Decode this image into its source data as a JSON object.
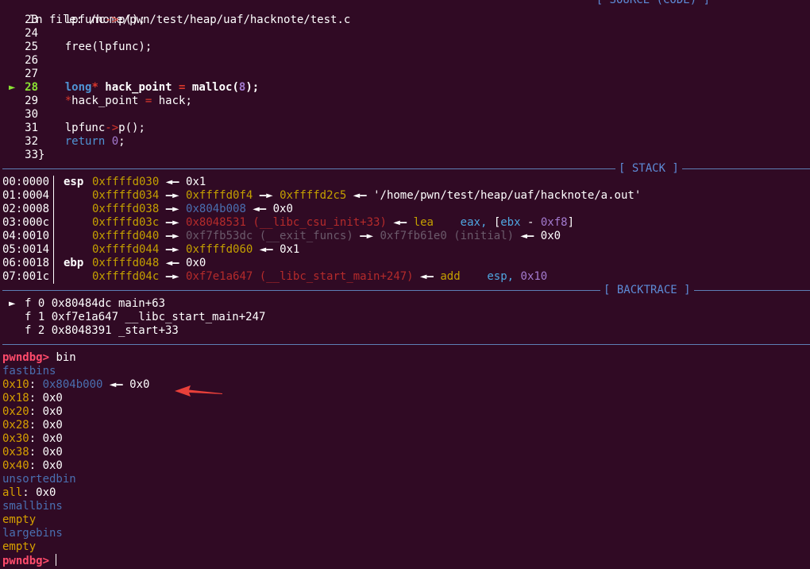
{
  "header": {
    "file_label": "In file: /home/pwn/test/heap/uaf/hacknote/test.c",
    "top_banner": "[ SOURCE (CODE) ]"
  },
  "source": {
    "lines": [
      {
        "num": "23",
        "code": "    lpfunc->p();"
      },
      {
        "num": "24",
        "code": ""
      },
      {
        "num": "25",
        "code": "    free(lpfunc);"
      },
      {
        "num": "26",
        "code": ""
      },
      {
        "num": "27",
        "code": ""
      },
      {
        "num": "28",
        "code": "    long* hack_point = malloc(8);",
        "current": true,
        "marker": "►"
      },
      {
        "num": "29",
        "code": "    *hack_point = hack;"
      },
      {
        "num": "30",
        "code": ""
      },
      {
        "num": "31",
        "code": "    lpfunc->p();"
      },
      {
        "num": "32",
        "code": "    return 0;"
      },
      {
        "num": "33",
        "code": "}"
      }
    ]
  },
  "stack": {
    "title": "[ STACK ]",
    "rows": [
      {
        "off": "00:0000",
        "reg": "esp",
        "addr": "0xffffd030",
        "rest": "0x1"
      },
      {
        "off": "01:0004",
        "reg": "",
        "addr": "0xffffd034",
        "rest": "0xffffd0f4",
        "rest2": "0xffffd2c5",
        "rest3": "'/home/pwn/test/heap/uaf/hacknote/a.out'"
      },
      {
        "off": "02:0008",
        "reg": "",
        "addr": "0xffffd038",
        "rest": "0x804b008",
        "rest2": "0x0"
      },
      {
        "off": "03:000c",
        "reg": "",
        "addr": "0xffffd03c",
        "rest": "0x8048531 (__libc_csu_init+33)",
        "instr": "lea",
        "ops1": "eax, [",
        "ops2": "ebx",
        "ops3": " - ",
        "ops4": "0xf8",
        "ops5": "]"
      },
      {
        "off": "04:0010",
        "reg": "",
        "addr": "0xffffd040",
        "rest": "0xf7fb53dc (__exit_funcs)",
        "rest2": "0xf7fb61e0 (initial)",
        "rest3": "0x0"
      },
      {
        "off": "05:0014",
        "reg": "",
        "addr": "0xffffd044",
        "rest": "0xffffd060",
        "rest2": "0x1"
      },
      {
        "off": "06:0018",
        "reg": "ebp",
        "addr": "0xffffd048",
        "rest": "0x0"
      },
      {
        "off": "07:001c",
        "reg": "",
        "addr": "0xffffd04c",
        "rest": "0xf7e1a647 (__libc_start_main+247)",
        "instr": "add",
        "ops1": "esp, ",
        "ops2": "0x10"
      }
    ]
  },
  "backtrace": {
    "title": "[ BACKTRACE ]",
    "frames": [
      {
        "marker": "►",
        "text": "f 0 0x80484dc main+63"
      },
      {
        "marker": "",
        "text": "f 1 0xf7e1a647 __libc_start_main+247"
      },
      {
        "marker": "",
        "text": "f 2 0x8048391 _start+33"
      }
    ]
  },
  "shell": {
    "prompt": "pwndbg>",
    "command": "bin",
    "fastbins_label": "fastbins",
    "fastbins": [
      {
        "size": "0x10",
        "value": "0x804b000",
        "tail": "0x0"
      },
      {
        "size": "0x18",
        "value": "0x0"
      },
      {
        "size": "0x20",
        "value": "0x0"
      },
      {
        "size": "0x28",
        "value": "0x0"
      },
      {
        "size": "0x30",
        "value": "0x0"
      },
      {
        "size": "0x38",
        "value": "0x0"
      },
      {
        "size": "0x40",
        "value": "0x0"
      }
    ],
    "unsortedbin_label": "unsortedbin",
    "unsorted_all_key": "all",
    "unsorted_all_value": "0x0",
    "smallbins_label": "smallbins",
    "smallbins_value": "empty",
    "largebins_label": "largebins",
    "largebins_value": "empty",
    "final_prompt": "pwndbg>"
  },
  "colors": {
    "background": "#300a24",
    "annotation_arrow": "#e8403a"
  }
}
